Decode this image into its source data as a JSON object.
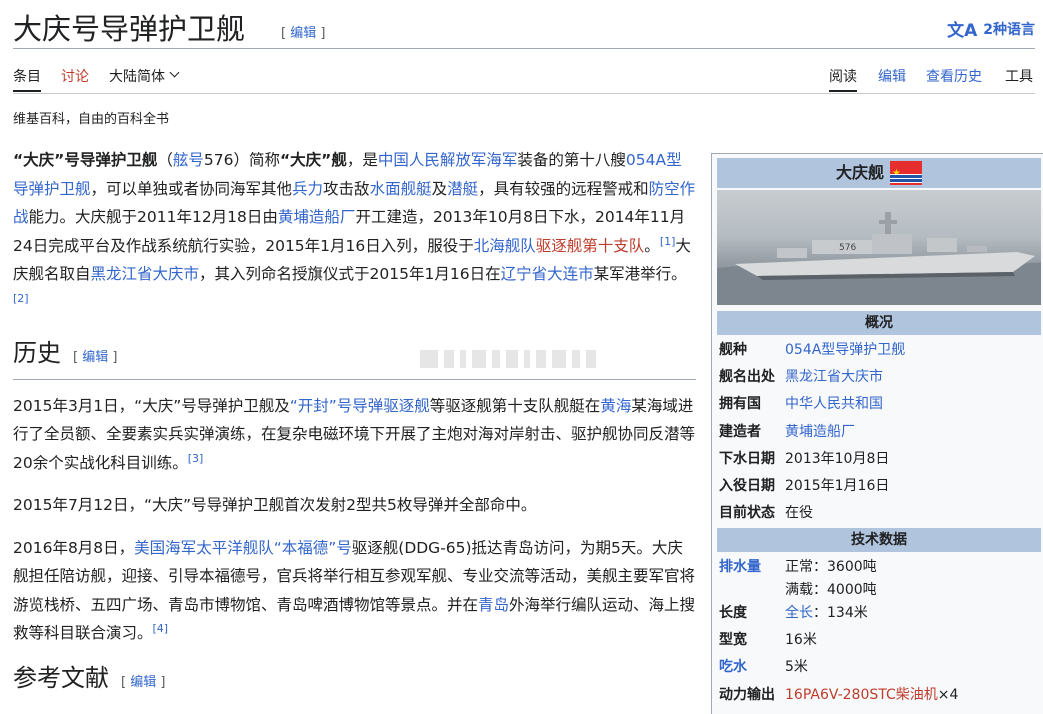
{
  "header": {
    "title": "大庆号导弹护卫舰",
    "edit_label": "编辑",
    "language_count": "2种语言",
    "lang_icon": "文A"
  },
  "tabs": {
    "article": "条目",
    "talk": "讨论",
    "variant": "大陆简体",
    "read": "阅读",
    "edit": "编辑",
    "history": "查看历史",
    "tools": "工具"
  },
  "tagline": "维基百科，自由的百科全书",
  "intro": {
    "b1": "“大庆”号导弹护卫舰",
    "t1": "（",
    "l1": "舷号",
    "t2": "576）简称",
    "b2": "“大庆”舰",
    "t3": "，是",
    "l2": "中国人民解放军海军",
    "t4": "装备的第十八艘",
    "l3": "054A型导弹护卫舰",
    "t5": "，可以单独或者协同海军其他",
    "l4": "兵力",
    "t6": "攻击敌",
    "l5": "水面舰艇",
    "t7": "及",
    "l6": "潜艇",
    "t8": "，具有较强的远程警戒和",
    "l7": "防空作战",
    "t9": "能力。大庆舰于2011年12月18日由",
    "l8": "黄埔造船厂",
    "t10": "开工建造，2013年10月8日下水，2014年11月24日完成平台及作战系统航行实验，2015年1月16日入列，服役于",
    "l9": "北海舰队",
    "r1": "驱逐舰第十支队",
    "t11": "。",
    "ref1": "[1]",
    "t12": "大庆舰名取自",
    "l10": "黑龙江省大庆市",
    "t13": "，其入列命名授旗仪式于2015年1月16日在",
    "l11": "辽宁省大连市",
    "t14": "某军港举行。",
    "ref2": "[2]"
  },
  "history": {
    "heading": "历史",
    "edit_label": "编辑",
    "p1": {
      "t1": "2015年3月1日，“大庆”号导弹护卫舰及",
      "l1": "“开封”号导弹驱逐舰",
      "t2": "等驱逐舰第十支队舰艇在",
      "l2": "黄海",
      "t3": "某海域进行了全员额、全要素实兵实弹演练，在复杂电磁环境下开展了主炮对海对岸射击、驱护舰协同反潜等20余个实战化科目训练。",
      "ref": "[3]"
    },
    "p2": "2015年7月12日，“大庆”号导弹护卫舰首次发射2型共5枚导弹并全部命中。",
    "p3": {
      "t1": "2016年8月8日，",
      "l1": "美国海军",
      "l2": "太平洋舰队",
      "l3": "“本福德”号",
      "t2": "驱逐舰(DDG-65)抵达青岛访问，为期5天。大庆舰担任陪访舰，迎接、引导本福德号，官兵将举行相互参观军舰、专业交流等活动，美舰主要军官将游览栈桥、五四广场、青岛市博物馆、青岛啤酒博物馆等景点。并在",
      "l4": "青岛",
      "t3": "外海举行编队运动、海上搜救等科目联合演习。",
      "ref": "[4]"
    }
  },
  "references": {
    "heading": "参考文献",
    "edit_label": "编辑"
  },
  "infobox": {
    "title": "大庆舰",
    "section_overview": "概况",
    "rows": [
      {
        "k": "舰种",
        "v": "054A型导弹护卫舰"
      },
      {
        "k": "舰名出处",
        "v": "黑龙江省大庆市"
      },
      {
        "k": "拥有国",
        "v": "中华人民共和国"
      },
      {
        "k": "建造者",
        "v": "黄埔造船厂"
      },
      {
        "k": "下水日期",
        "v": "2013年10月8日"
      },
      {
        "k": "入役日期",
        "v": "2015年1月16日"
      },
      {
        "k": "目前状态",
        "v": "在役"
      }
    ],
    "section_tech": "技术数据",
    "displacement_k": "排水量",
    "displacement_1": "正常：3600吨",
    "displacement_2": "满载：4000吨",
    "length_k": "长度",
    "length_link": "全长",
    "length_v": "：134米",
    "beam_k": "型宽",
    "beam_v": "16米",
    "draft_k": "吃水",
    "draft_v": "5米",
    "power_k": "动力输出",
    "power_link": "16PA6V-280STC柴油机",
    "power_v": "×4"
  },
  "colors": {
    "link": "#3366cc",
    "redlink": "#bf3c2c",
    "infobox_header": "#b0c4de"
  }
}
